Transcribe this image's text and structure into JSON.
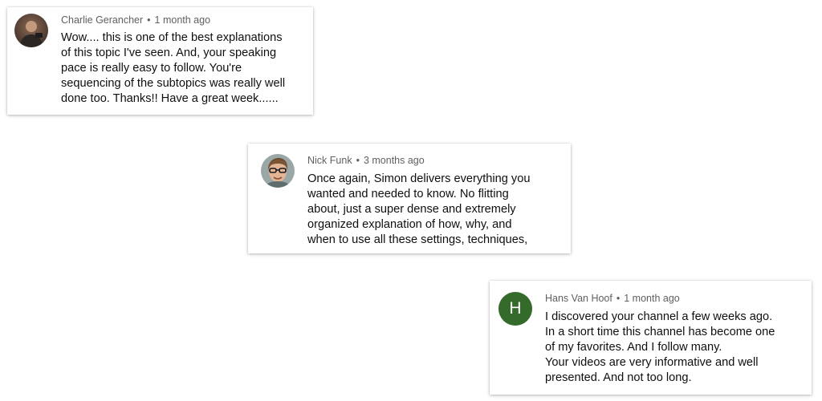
{
  "comments": [
    {
      "author": "Charlie Gerancher",
      "separator": "•",
      "time": "1 month ago",
      "avatar_icon": "person-photo",
      "lines": [
        "Wow.... this is one of the best explanations",
        "of this topic I've seen. And, your speaking",
        "pace is really easy to follow. You're",
        "sequencing of the subtopics was really well",
        "done too. Thanks!! Have a great week......"
      ]
    },
    {
      "author": "Nick Funk",
      "separator": "•",
      "time": "3 months ago",
      "avatar_icon": "person-photo-glasses",
      "lines": [
        "Once again, Simon delivers everything you",
        "wanted and needed to know. No flitting",
        "about, just a super dense and extremely",
        "organized explanation of how, why, and",
        "when to use all these settings, techniques,"
      ]
    },
    {
      "author": "Hans Van Hoof",
      "separator": "•",
      "time": "1 month ago",
      "avatar_letter": "H",
      "avatar_color": "#356b2a",
      "lines": [
        "I discovered your channel a few weeks ago.",
        "In a short time this channel has become one",
        "of my favorites. And I follow many.",
        "Your videos are very informative and well",
        "presented. And not too long."
      ]
    }
  ]
}
